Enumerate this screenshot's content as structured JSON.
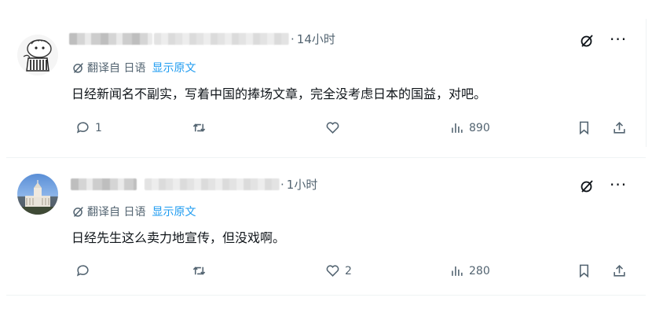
{
  "tweets": [
    {
      "time": "14小时",
      "translate_label": "翻译自 日语",
      "show_original": "显示原文",
      "text": "日经新闻名不副实，写着中国的捧场文章，完全没考虑日本的国益，对吧。",
      "replies": "1",
      "retweets": "",
      "likes": "",
      "views": "890",
      "avatar": "sketch-character-avatar"
    },
    {
      "time": "1小时",
      "translate_label": "翻译自 日语",
      "show_original": "显示原文",
      "text": "日经先生这么卖力地宣传，但没戏啊。",
      "replies": "",
      "retweets": "",
      "likes": "2",
      "views": "280",
      "avatar": "diet-building-avatar"
    }
  ],
  "ui": {
    "separator_dot": "·",
    "more_label": "···"
  },
  "colors": {
    "text_primary": "#0f1419",
    "text_secondary": "#536471",
    "link": "#1d9bf0",
    "border": "#eff3f4"
  }
}
